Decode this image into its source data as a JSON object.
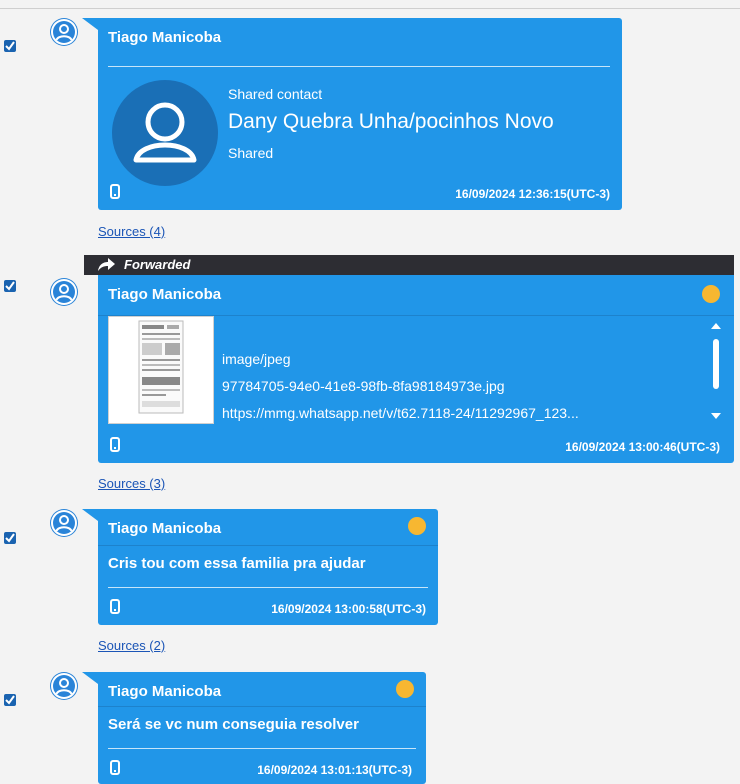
{
  "messages": [
    {
      "sender": "Tiago Manicoba",
      "type": "contact",
      "shared_label": "Shared contact",
      "contact_name": "Dany Quebra Unha/pocinhos Novo",
      "status": "Shared",
      "timestamp": "16/09/2024 12:36:15(UTC-3)",
      "sources": "Sources (4)"
    },
    {
      "sender": "Tiago Manicoba",
      "type": "attachment",
      "forwarded_label": "Forwarded",
      "mime": "image/jpeg",
      "filename": "97784705-94e0-41e8-98fb-8fa98184973e.jpg",
      "url": "https://mmg.whatsapp.net/v/t62.7118-24/11292967_123...",
      "timestamp": "16/09/2024 13:00:46(UTC-3)",
      "sources": "Sources (3)"
    },
    {
      "sender": "Tiago Manicoba",
      "type": "text",
      "text": "Cris tou com essa familia pra ajudar",
      "timestamp": "16/09/2024 13:00:58(UTC-3)",
      "sources": "Sources (2)"
    },
    {
      "sender": "Tiago Manicoba",
      "type": "text",
      "text": "Será se vc num conseguia resolver",
      "timestamp": "16/09/2024 13:01:13(UTC-3)"
    }
  ],
  "colors": {
    "bubble": "#2196e8",
    "forward_bar": "#2d2d33",
    "status_dot": "#f7b731",
    "link": "#1b55b6",
    "checkbox": "#1a63b0"
  },
  "icons": {
    "avatar": "person-circle-icon",
    "device": "phone-icon",
    "forward": "forward-arrow-icon",
    "checkbox": "checkbox-checked-icon"
  }
}
